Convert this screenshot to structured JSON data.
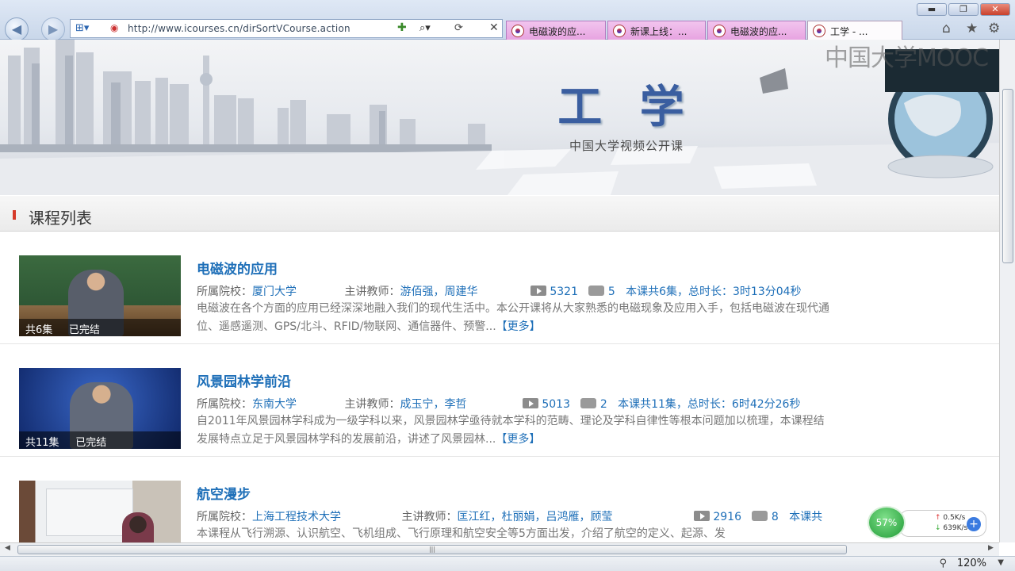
{
  "browser": {
    "url": "http://www.icourses.cn/dirSortVCourse.action",
    "url_domain": "www.icourses.cn",
    "tabs": [
      {
        "label": "电磁波的应..."
      },
      {
        "label": "新课上线：..."
      },
      {
        "label": "电磁波的应..."
      },
      {
        "label": "工学 - ..."
      }
    ],
    "zoom": "120%"
  },
  "banner": {
    "title": "工 学",
    "subtitle": "中国大学视频公开课"
  },
  "watermark": "中国大学MOOC",
  "section": {
    "title": "课程列表"
  },
  "courses": [
    {
      "title": "电磁波的应用",
      "school_label": "所属院校：",
      "school": "厦门大学",
      "teacher_label": "主讲教师：",
      "teachers": "游佰强，周建华",
      "views": "5321",
      "comments": "5",
      "summary": "本课共6集，总时长：3时13分04秒",
      "desc_line1": "电磁波在各个方面的应用已经深深地融入我们的现代生活中。本公开课将从大家熟悉的电磁现象及应用入手，包括电磁波在现代通",
      "desc_line2": "位、遥感遥测、GPS/北斗、RFID/物联网、通信器件、预警...",
      "more": "【更多】",
      "caption": "共6集     已完结"
    },
    {
      "title": "风景园林学前沿",
      "school_label": "所属院校：",
      "school": "东南大学",
      "teacher_label": "主讲教师：",
      "teachers": "成玉宁，李哲",
      "views": "5013",
      "comments": "2",
      "summary": "本课共11集，总时长：6时42分26秒",
      "desc_line1": "自2011年风景园林学科成为一级学科以来，风景园林学亟待就本学科的范畴、理论及学科自律性等根本问题加以梳理，本课程结",
      "desc_line2": "发展特点立足于风景园林学科的发展前沿，讲述了风景园林...",
      "more": "【更多】",
      "caption": "共11集     已完结"
    },
    {
      "title": "航空漫步",
      "school_label": "所属院校：",
      "school": "上海工程技术大学",
      "teacher_label": "主讲教师：",
      "teachers": "匡江红，杜丽娟，吕鸿雁，顾莹",
      "views": "2916",
      "comments": "8",
      "summary": "本课共",
      "desc_line1": "本课程从飞行溯源、认识航空、飞机组成、飞行原理和航空安全等5方面出发，介绍了航空的定义、起源、发",
      "desc_line2": "",
      "more": "",
      "caption": ""
    }
  ],
  "widget": {
    "percent": "57%",
    "up": "0.5K/s",
    "down": "639K/s"
  },
  "colors": {
    "link": "#1e6fb8",
    "accent": "#d63a2a"
  }
}
